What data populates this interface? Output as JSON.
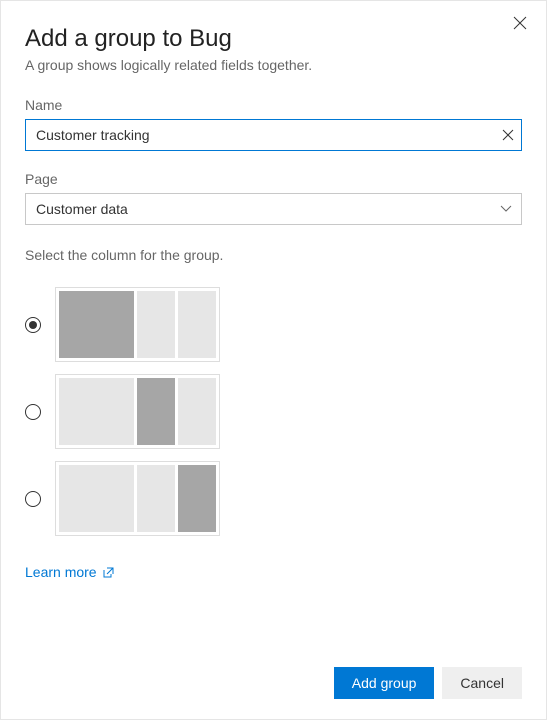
{
  "header": {
    "title": "Add a group to Bug",
    "subtitle": "A group shows logically related fields together."
  },
  "nameField": {
    "label": "Name",
    "value": "Customer tracking"
  },
  "pageField": {
    "label": "Page",
    "value": "Customer data"
  },
  "columnSection": {
    "instruction": "Select the column for the group.",
    "selectedIndex": 0
  },
  "learnMore": {
    "label": "Learn more"
  },
  "footer": {
    "primaryLabel": "Add group",
    "secondaryLabel": "Cancel"
  }
}
